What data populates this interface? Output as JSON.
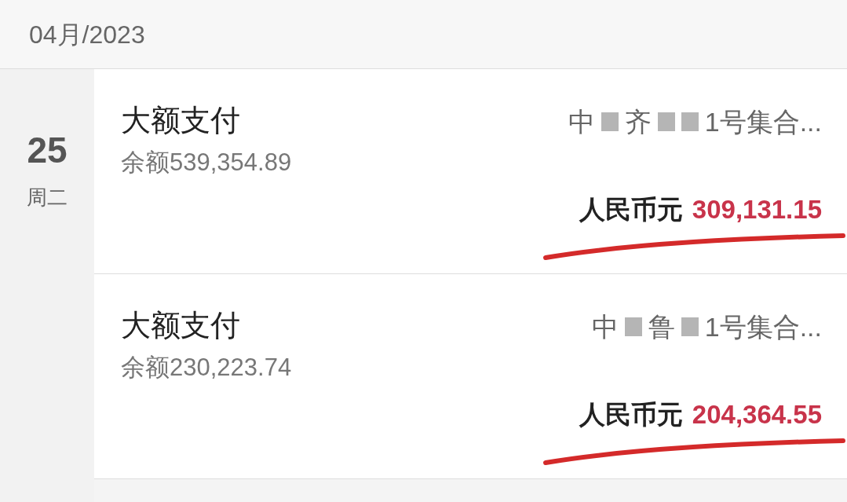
{
  "month_header": "04月/2023",
  "date": {
    "day": "25",
    "weekday": "周二"
  },
  "transactions": [
    {
      "title": "大额支付",
      "balance": "余额539,354.89",
      "counterparty": [
        {
          "kind": "text",
          "text": "中"
        },
        {
          "kind": "redaction"
        },
        {
          "kind": "text",
          "text": "齐"
        },
        {
          "kind": "redaction"
        },
        {
          "kind": "redaction"
        },
        {
          "kind": "text",
          "text": "1号集合..."
        }
      ],
      "currency": "人民币元",
      "amount": "309,131.15",
      "underlined": true
    },
    {
      "title": "大额支付",
      "balance": "余额230,223.74",
      "counterparty": [
        {
          "kind": "text",
          "text": "中"
        },
        {
          "kind": "redaction"
        },
        {
          "kind": "text",
          "text": "鲁"
        },
        {
          "kind": "redaction"
        },
        {
          "kind": "text",
          "text": "1号集合..."
        }
      ],
      "currency": "人民币元",
      "amount": "204,364.55",
      "underlined": true
    }
  ]
}
